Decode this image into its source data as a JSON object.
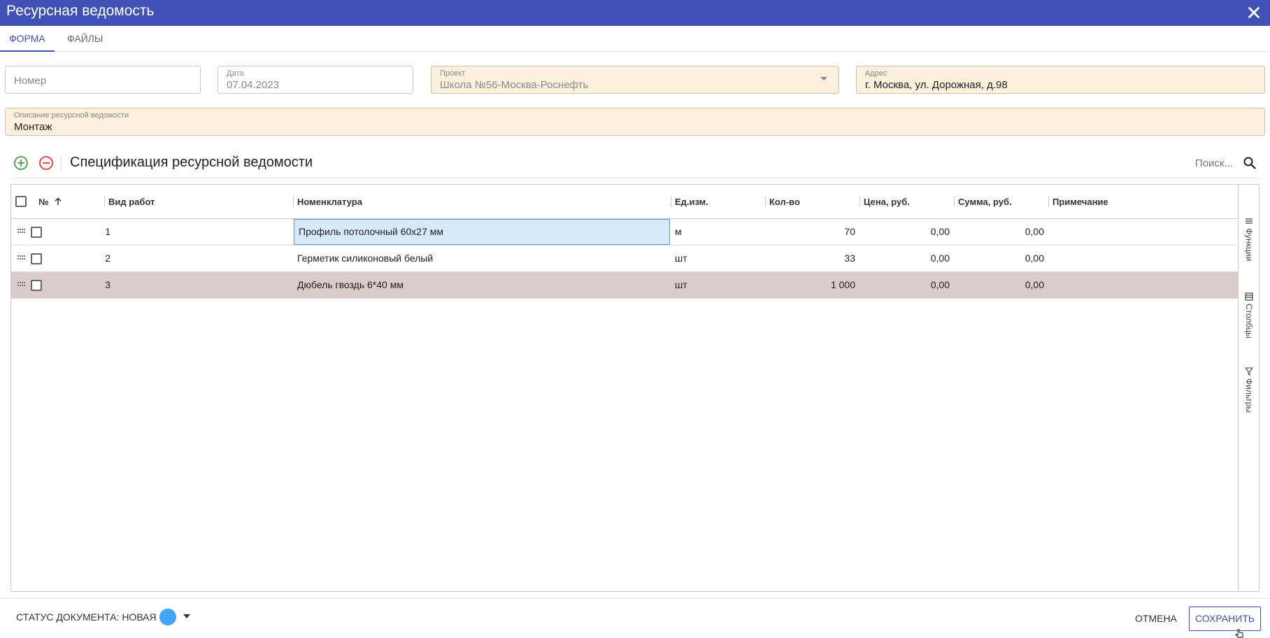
{
  "window": {
    "title": "Ресурсная ведомость"
  },
  "tabs": [
    {
      "label": "Форма",
      "active": true
    },
    {
      "label": "Файлы",
      "active": false
    }
  ],
  "form": {
    "number": {
      "placeholder": "Номер"
    },
    "date": {
      "label": "Дата",
      "value": "07.04.2023"
    },
    "project": {
      "label": "Проект",
      "value": "Школа №56-Москва-Роснефть"
    },
    "address": {
      "label": "Адрес",
      "value": "г. Москва, ул. Дорожная, д.98"
    },
    "description": {
      "label": "Описание ресурсной ведомости",
      "value": "Монтаж"
    }
  },
  "spec": {
    "title": "Спецификация ресурсной ведомости",
    "search_placeholder": "Поиск...",
    "columns": {
      "num": "№",
      "work_type": "Вид работ",
      "nomenclature": "Номенклатура",
      "unit": "Ед.изм.",
      "qty": "Кол-во",
      "price": "Цена, руб.",
      "sum": "Сумма, руб.",
      "note": "Примечание"
    },
    "rows": [
      {
        "num": "1",
        "work_type": "",
        "nomenclature": "Профиль потолочный 60x27 мм",
        "unit": "м",
        "qty": "70",
        "price": "0,00",
        "sum": "0,00",
        "note": ""
      },
      {
        "num": "2",
        "work_type": "",
        "nomenclature": "Герметик силиконовый белый",
        "unit": "шт",
        "qty": "33",
        "price": "0,00",
        "sum": "0,00",
        "note": ""
      },
      {
        "num": "3",
        "work_type": "",
        "nomenclature": "Дюбель гвоздь 6*40 мм",
        "unit": "шт",
        "qty": "1 000",
        "price": "0,00",
        "sum": "0,00",
        "note": ""
      }
    ],
    "side_panel": {
      "functions": "Функции",
      "columns": "Столбцы",
      "filters": "Фильтры"
    }
  },
  "footer": {
    "status_text": "Статус документа: Новая",
    "status_color": "#42a5f5",
    "cancel_label": "Отмена",
    "save_label": "Сохранить"
  },
  "colors": {
    "header": "#3f51b5",
    "filled_field": "#fdf0dd",
    "selected_row": "#d9cccb",
    "focused_cell": "#d7eafb"
  }
}
